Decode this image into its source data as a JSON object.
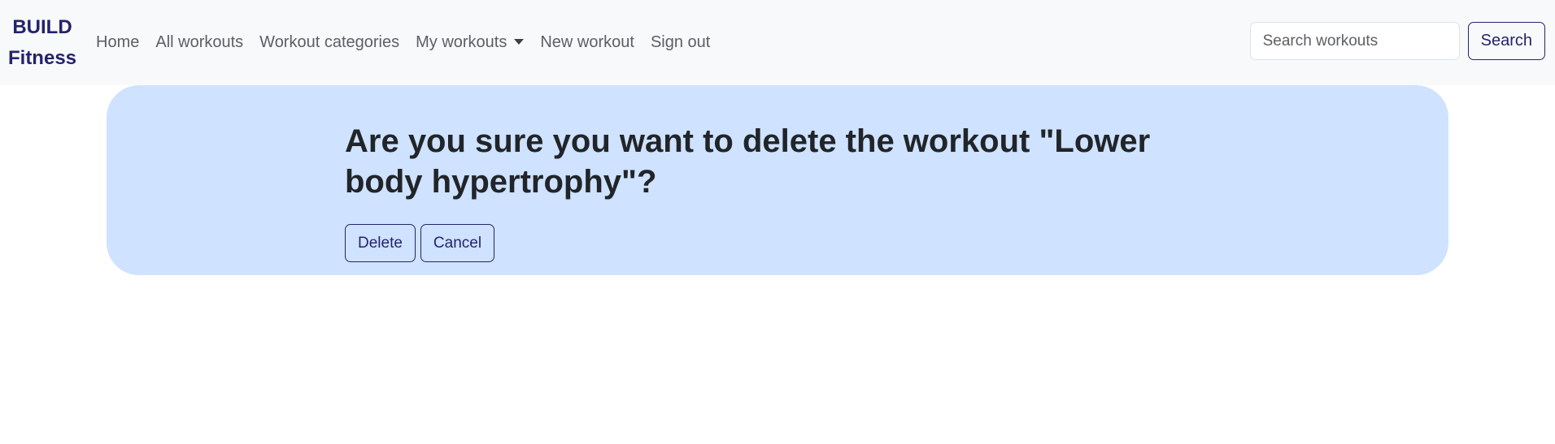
{
  "navbar": {
    "brand": {
      "line1": "BUILD",
      "line2": "Fitness"
    },
    "links": [
      {
        "label": "Home"
      },
      {
        "label": "All workouts"
      },
      {
        "label": "Workout categories"
      },
      {
        "label": "My workouts",
        "has_dropdown": true
      },
      {
        "label": "New workout"
      },
      {
        "label": "Sign out"
      }
    ],
    "search": {
      "placeholder": "Search workouts",
      "value": "",
      "button_label": "Search"
    }
  },
  "confirm": {
    "title": "Are you sure you want to delete the workout \"Lower body hypertrophy\"?",
    "delete_label": "Delete",
    "cancel_label": "Cancel"
  },
  "colors": {
    "brand": "#25236b",
    "navbar_bg": "#f8f9fa",
    "panel_bg": "#cfe2ff",
    "nav_text": "#5c5f63"
  },
  "icons": {
    "dropdown": "caret-down-icon"
  }
}
